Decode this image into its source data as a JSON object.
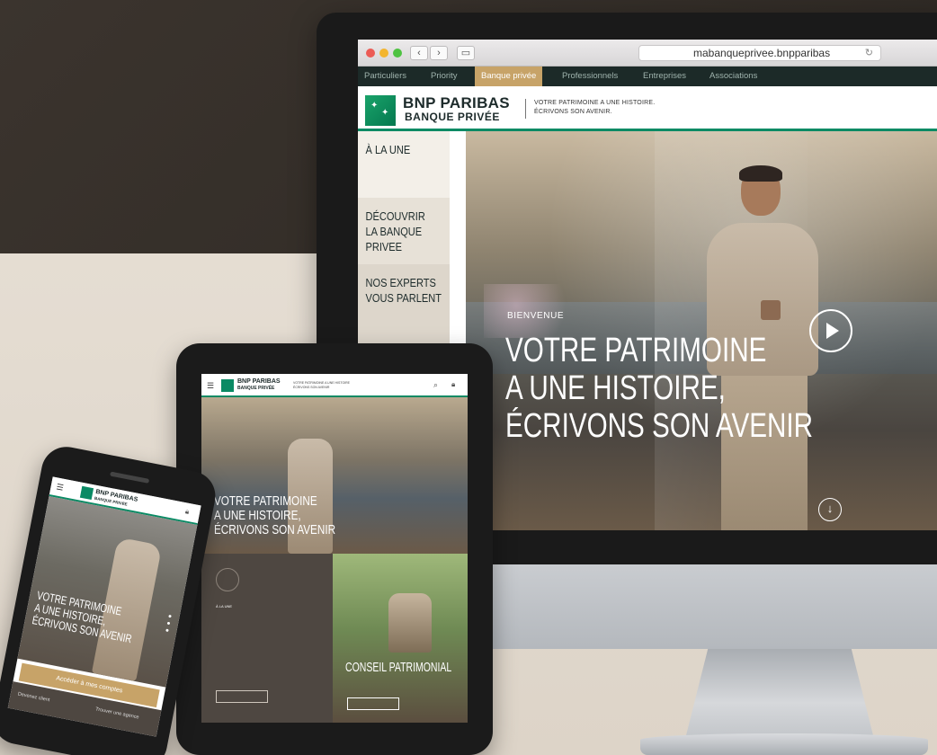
{
  "browser": {
    "url": "mabanqueprivee.bnpparibas",
    "back_icon": "chevron-left-icon",
    "forward_icon": "chevron-right-icon",
    "sidebar_icon": "sidebar-icon",
    "reload_icon": "reload-icon"
  },
  "site_nav": [
    "Particuliers",
    "Priority",
    "Banque privée",
    "Professionnels",
    "Entreprises",
    "Associations"
  ],
  "brand": {
    "name": "BNP PARIBAS",
    "sub": "BANQUE PRIVÉE",
    "tag_line1": "VOTRE PATRIMOINE A UNE HISTOIRE.",
    "tag_line2": "ÉCRIVONS SON AVENIR."
  },
  "side_menu": [
    "À LA UNE",
    "DÉCOUVRIR\nLA BANQUE PRIVEE",
    "NOS EXPERTS\nVOUS PARLENT"
  ],
  "hero": {
    "kicker": "BIENVENUE",
    "line1": "VOTRE PATRIMOINE",
    "line2": "A UNE HISTOIRE,",
    "line3": "ÉCRIVONS SON AVENIR"
  },
  "tablet": {
    "brand": "BNP PARIBAS",
    "brand_sub": "BANQUE PRIVÉE",
    "tag_line1": "VOTRE PATRIMOINE A UNE HISTOIRE",
    "tag_line2": "ÉCRIVONS SON AVENIR",
    "hero_line1": "VOTRE PATRIMOINE",
    "hero_line2": "A UNE HISTOIRE,",
    "hero_line3": "ÉCRIVONS SON AVENIR",
    "section_title": "À LA UNE",
    "right_title": "CONSEIL PATRIMONIAL"
  },
  "phone": {
    "brand": "BNP PARIBAS",
    "brand_sub": "BANQUE PRIVÉE",
    "hero_line1": "VOTRE PATRIMOINE",
    "hero_line2": "A UNE HISTOIRE,",
    "hero_line3": "ÉCRIVONS SON AVENIR",
    "cta": "Accéder à mes comptes",
    "link_left": "Devenez client",
    "link_right": "Trouver une agence"
  }
}
